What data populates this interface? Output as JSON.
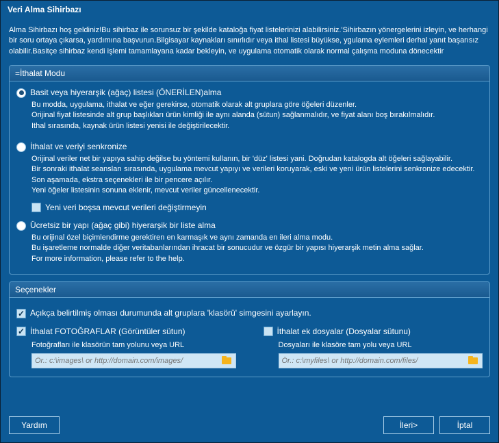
{
  "title": "Veri Alma Sihirbazı",
  "intro": "Alma Sihirbazı hoş geldiniz!Bu sihirbaz ile sorunsuz bir şekilde kataloğa fiyat listelerinizi alabilirsiniz.'Sihirbazın yönergelerini izleyin, ve herhangi bir soru ortaya çıkarsa, yardımına başvurun.Bilgisayar kaynakları sınırlıdır veya ithal listesi büyükse, ygulama eylemleri derhal yanıt başarısız olabilir.Basitçe sihirbaz kendi işlemi tamamlayana kadar bekleyin, ve uygulama otomatik olarak normal çalışma moduna dönecektir",
  "importMode": {
    "header": "=İthalat Modu",
    "opt1": {
      "label": "Basit veya hiyerarşik (ağaç) listesi (ÖNERİLEN)alma",
      "desc1": "Bu modda, uygulama, ithalat ve eğer gerekirse, otomatik olarak alt gruplara göre öğeleri düzenler.",
      "desc2": "Orijinal fiyat listesinde alt grup başlıkları ürün kimliği ile aynı alanda (sütun) sağlanmalıdır, ve fiyat alanı boş bırakılmalıdır.",
      "desc3": "Ithal sırasında, kaynak ürün listesi yenisi ile değiştirilecektir."
    },
    "opt2": {
      "label": "İthalat ve veriyi senkronize",
      "desc1": "Orijinal veriler net bir yapıya sahip değilse bu yöntemi kullanın, bir 'düz' listesi yani. Doğrudan katalogda alt öğeleri sağlayabilir.",
      "desc2": "Bir sonraki ithalat seansları sırasında, uygulama mevcut yapıyı ve verileri koruyarak, eski ve yeni ürün listelerini senkronize edecektir.",
      "desc3": "Son aşamada, ekstra seçenekleri ile bir pencere açılır.",
      "desc4": "Yeni öğeler listesinin sonuna eklenir, mevcut veriler güncellenecektir.",
      "dontReplace": "Yeni veri boşsa mevcut verileri değiştirmeyin"
    },
    "opt3": {
      "label": "Ücretsiz bir yapı (ağaç gibi) hiyerarşik bir liste alma",
      "desc1": "Bu orijinal özel biçimlendirme gerektiren en karmaşık ve aynı zamanda en ileri alma modu.",
      "desc2": "Bu işaretleme normalde diğer veritabanlarından ihracat bir sonucudur ve özgür bir yapısı hiyerarşik metin alma sağlar.",
      "desc3": "For more information, please refer to the help."
    }
  },
  "options": {
    "header": "Seçenekler",
    "explicitFolder": "Açıkça belirtilmiş olması durumunda alt gruplara 'klasörü' simgesini ayarlayın.",
    "importPhotos": "İthalat FOTOĞRAFLAR (Görüntüler sütun)",
    "importFiles": "İthalat ek dosyalar (Dosyalar sütunu)",
    "photoPathLabel": "Fotoğrafları ile klasörün tam yolunu veya URL",
    "filePathLabel": "Dosyaları ile klasöre tam yolu veya URL",
    "photoPlaceholder": "Ör.: c:\\images\\ or http://domain.com/images/",
    "filePlaceholder": "Ör.: c:\\myfiles\\ or http://domain.com/files/"
  },
  "buttons": {
    "help": "Yardım",
    "next": "İleri>",
    "cancel": "İptal"
  }
}
